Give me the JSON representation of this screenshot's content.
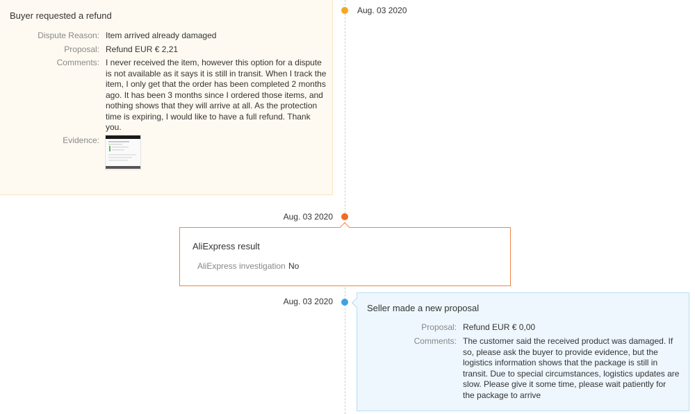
{
  "timeline": {
    "events": [
      {
        "date": "Aug. 03 2020",
        "dot_color": "#f5a623",
        "title": "Buyer requested a refund",
        "fields": {
          "dispute_reason_label": "Dispute Reason:",
          "dispute_reason_value": "Item arrived already damaged",
          "proposal_label": "Proposal:",
          "proposal_value": "Refund EUR € 2,21",
          "comments_label": "Comments:",
          "comments_value": "I never received the item, however this option for a dispute is not available as it says it is still in transit. When I track the item, I only get that the order has been completed 2 months ago. It has been 3 months since I ordered those items, and nothing shows that they will arrive at all. As the protection time is expiring, I would like to have a full refund. Thank you.",
          "evidence_label": "Evidence:"
        }
      },
      {
        "date": "Aug. 03 2020",
        "dot_color": "#f26b21",
        "title": "AliExpress result",
        "fields": {
          "investigation_label": "AliExpress investigation",
          "investigation_value": "No"
        }
      },
      {
        "date": "Aug. 03 2020",
        "dot_color": "#3ea1e4",
        "title": "Seller made a new proposal",
        "fields": {
          "proposal_label": "Proposal:",
          "proposal_value": "Refund EUR € 0,00",
          "comments_label": "Comments:",
          "comments_value": "The customer said the received product was damaged. If so, please ask the buyer to provide evidence, but the logistics information shows that the package is still in transit. Due to special circumstances, logistics updates are slow. Please give it some time, please wait patiently for the package to arrive"
        }
      }
    ]
  }
}
